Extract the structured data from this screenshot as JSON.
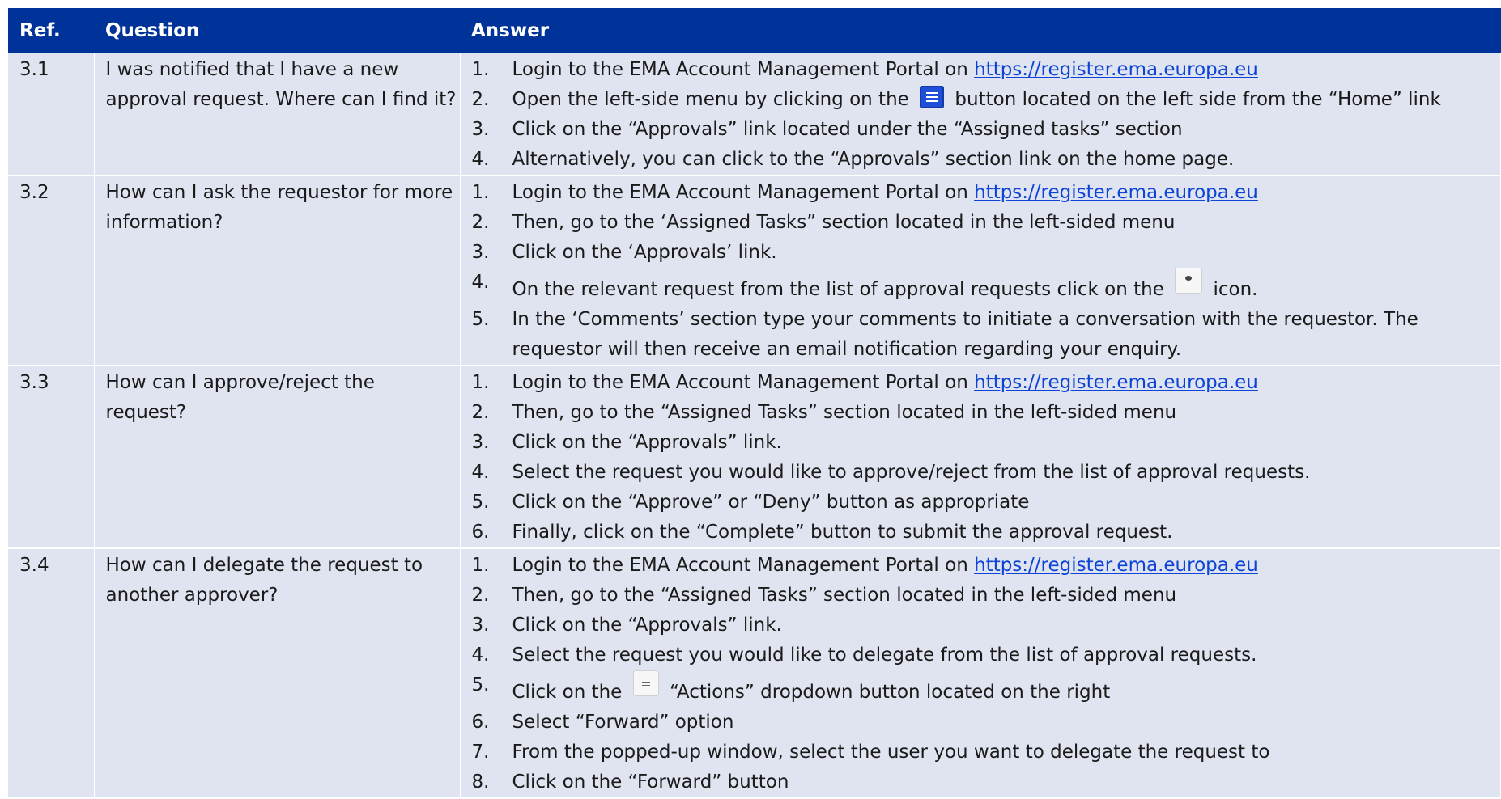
{
  "header": {
    "ref": "Ref.",
    "question": "Question",
    "answer": "Answer"
  },
  "rows": [
    {
      "ref": "3.1",
      "question": "I was notified that I have a new approval request. Where can I find it?",
      "steps": [
        {
          "num": "1.",
          "pre": "Login to the EMA Account Management Portal on ",
          "link": "https://register.ema.europa.eu"
        },
        {
          "num": "2.",
          "pre": "Open the left-side menu by clicking on the ",
          "icon": "menu-list-icon",
          "post": " button located on the left side from the “Home” link"
        },
        {
          "num": "3.",
          "text": "Click on the “Approvals” link located under the “Assigned tasks” section"
        },
        {
          "num": "4.",
          "text": "Alternatively, you can click to the “Approvals” section link on the home page."
        }
      ]
    },
    {
      "ref": "3.2",
      "question": "How can I ask the requestor for more information?",
      "steps": [
        {
          "num": "1.",
          "pre": "Login to the EMA Account Management Portal on ",
          "link": "https://register.ema.europa.eu"
        },
        {
          "num": "2.",
          "text": "Then, go to the ‘Assigned Tasks” section located in the left-sided menu"
        },
        {
          "num": "3.",
          "text": "Click on the ‘Approvals’ link."
        },
        {
          "num": "4.",
          "pre": "On  the relevant request from the list of approval requests click on the ",
          "icon": "comment-icon",
          "post": " icon."
        },
        {
          "num": "5.",
          "text": "In the ‘Comments’ section type your comments to initiate a conversation with the requestor. The requestor will then receive an email notification regarding your enquiry."
        }
      ]
    },
    {
      "ref": "3.3",
      "question": "How can I approve/reject the request?",
      "steps": [
        {
          "num": "1.",
          "pre": "Login to the EMA Account Management Portal on ",
          "link": "https://register.ema.europa.eu"
        },
        {
          "num": "2.",
          "text": "Then, go to the “Assigned Tasks” section located in the left-sided menu"
        },
        {
          "num": "3.",
          "text": "Click on the “Approvals” link."
        },
        {
          "num": "4.",
          "text": "Select the request you would like to approve/reject from the list of approval requests."
        },
        {
          "num": "5.",
          "text": "Click on the “Approve” or “Deny” button as appropriate"
        },
        {
          "num": "6.",
          "text": "Finally, click on the “Complete” button to submit the approval request."
        }
      ]
    },
    {
      "ref": "3.4",
      "question": "How can I delegate the request to another approver?",
      "steps": [
        {
          "num": "1.",
          "pre": "Login to the EMA Account Management Portal on ",
          "link": "https://register.ema.europa.eu"
        },
        {
          "num": "2.",
          "text": "Then, go to the “Assigned Tasks” section located in the left-sided menu"
        },
        {
          "num": "3.",
          "text": "Click on the “Approvals” link."
        },
        {
          "num": "4.",
          "text": "Select the request you would like to delegate from the list of approval requests."
        },
        {
          "num": "5.",
          "pre": "Click on the ",
          "icon": "actions-menu-icon",
          "post": " “Actions” dropdown button located on the right"
        },
        {
          "num": "6.",
          "text": "Select “Forward” option"
        },
        {
          "num": "7.",
          "text": "From the popped-up window, select the user you want to delegate the request to"
        },
        {
          "num": "8.",
          "text": "Click on the “Forward” button"
        }
      ]
    }
  ]
}
